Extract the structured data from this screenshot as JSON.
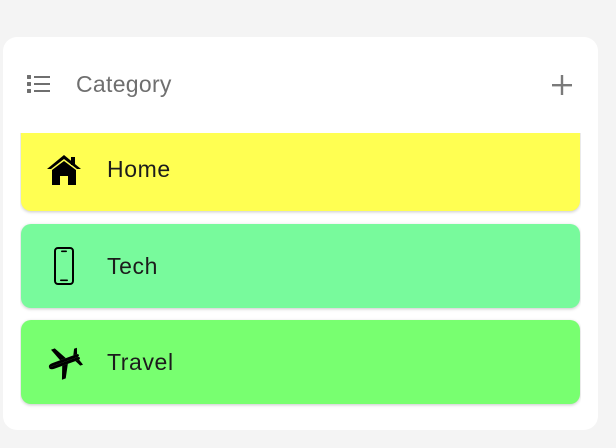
{
  "header": {
    "title": "Category",
    "list_icon": "list-icon",
    "add_icon": "plus-icon"
  },
  "categories": [
    {
      "label": "Home",
      "icon": "home-icon",
      "color": "#ffff52"
    },
    {
      "label": "Tech",
      "icon": "phone-icon",
      "color": "#78fa9c"
    },
    {
      "label": "Travel",
      "icon": "airplane-icon",
      "color": "#78ff70"
    }
  ],
  "colors": {
    "page_background": "#f4f4f4",
    "card_background": "#ffffff",
    "header_text": "#6f6f6f",
    "row_text": "#1c1c1c"
  }
}
